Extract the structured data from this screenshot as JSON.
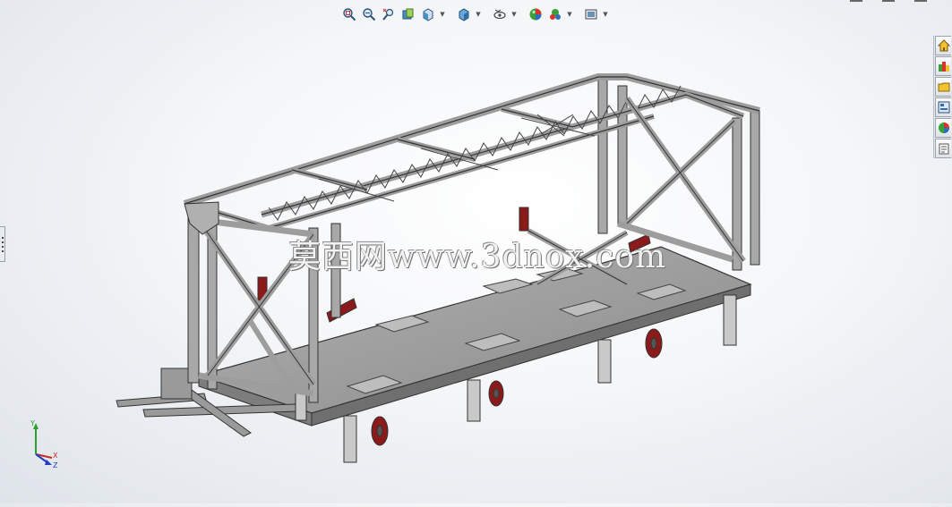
{
  "heads_up_toolbar": {
    "buttons": [
      {
        "name": "zoom-to-fit",
        "icon": "zoom-fit-icon",
        "has_dropdown": false
      },
      {
        "name": "zoom-to-area",
        "icon": "zoom-area-icon",
        "has_dropdown": false
      },
      {
        "name": "previous-view",
        "icon": "previous-view-icon",
        "has_dropdown": false
      },
      {
        "name": "section-view",
        "icon": "section-view-icon",
        "has_dropdown": false
      },
      {
        "name": "view-orientation",
        "icon": "view-orientation-icon",
        "has_dropdown": true
      },
      {
        "name": "display-style",
        "icon": "display-style-icon",
        "has_dropdown": true
      },
      {
        "name": "hide-show-items",
        "icon": "hide-show-icon",
        "has_dropdown": true
      },
      {
        "name": "edit-appearance",
        "icon": "appearance-icon",
        "has_dropdown": false
      },
      {
        "name": "apply-scene",
        "icon": "scene-icon",
        "has_dropdown": true
      },
      {
        "name": "view-settings",
        "icon": "view-settings-icon",
        "has_dropdown": true
      }
    ]
  },
  "task_pane": {
    "tabs": [
      {
        "name": "resources",
        "icon": "home-icon"
      },
      {
        "name": "design-library",
        "icon": "library-icon"
      },
      {
        "name": "file-explorer",
        "icon": "folder-icon"
      },
      {
        "name": "view-palette",
        "icon": "palette-icon"
      },
      {
        "name": "appearances",
        "icon": "appearance-sphere-icon"
      },
      {
        "name": "custom-properties",
        "icon": "properties-icon"
      }
    ]
  },
  "watermark": {
    "text": "莫西网www.3dnox.com"
  },
  "triad": {
    "x_label": "X",
    "y_label": "Y",
    "z_label": "Z"
  },
  "colors": {
    "frame": "#8f8f8f",
    "deck": "#a4a4a4",
    "accent": "#8b1a1a"
  }
}
